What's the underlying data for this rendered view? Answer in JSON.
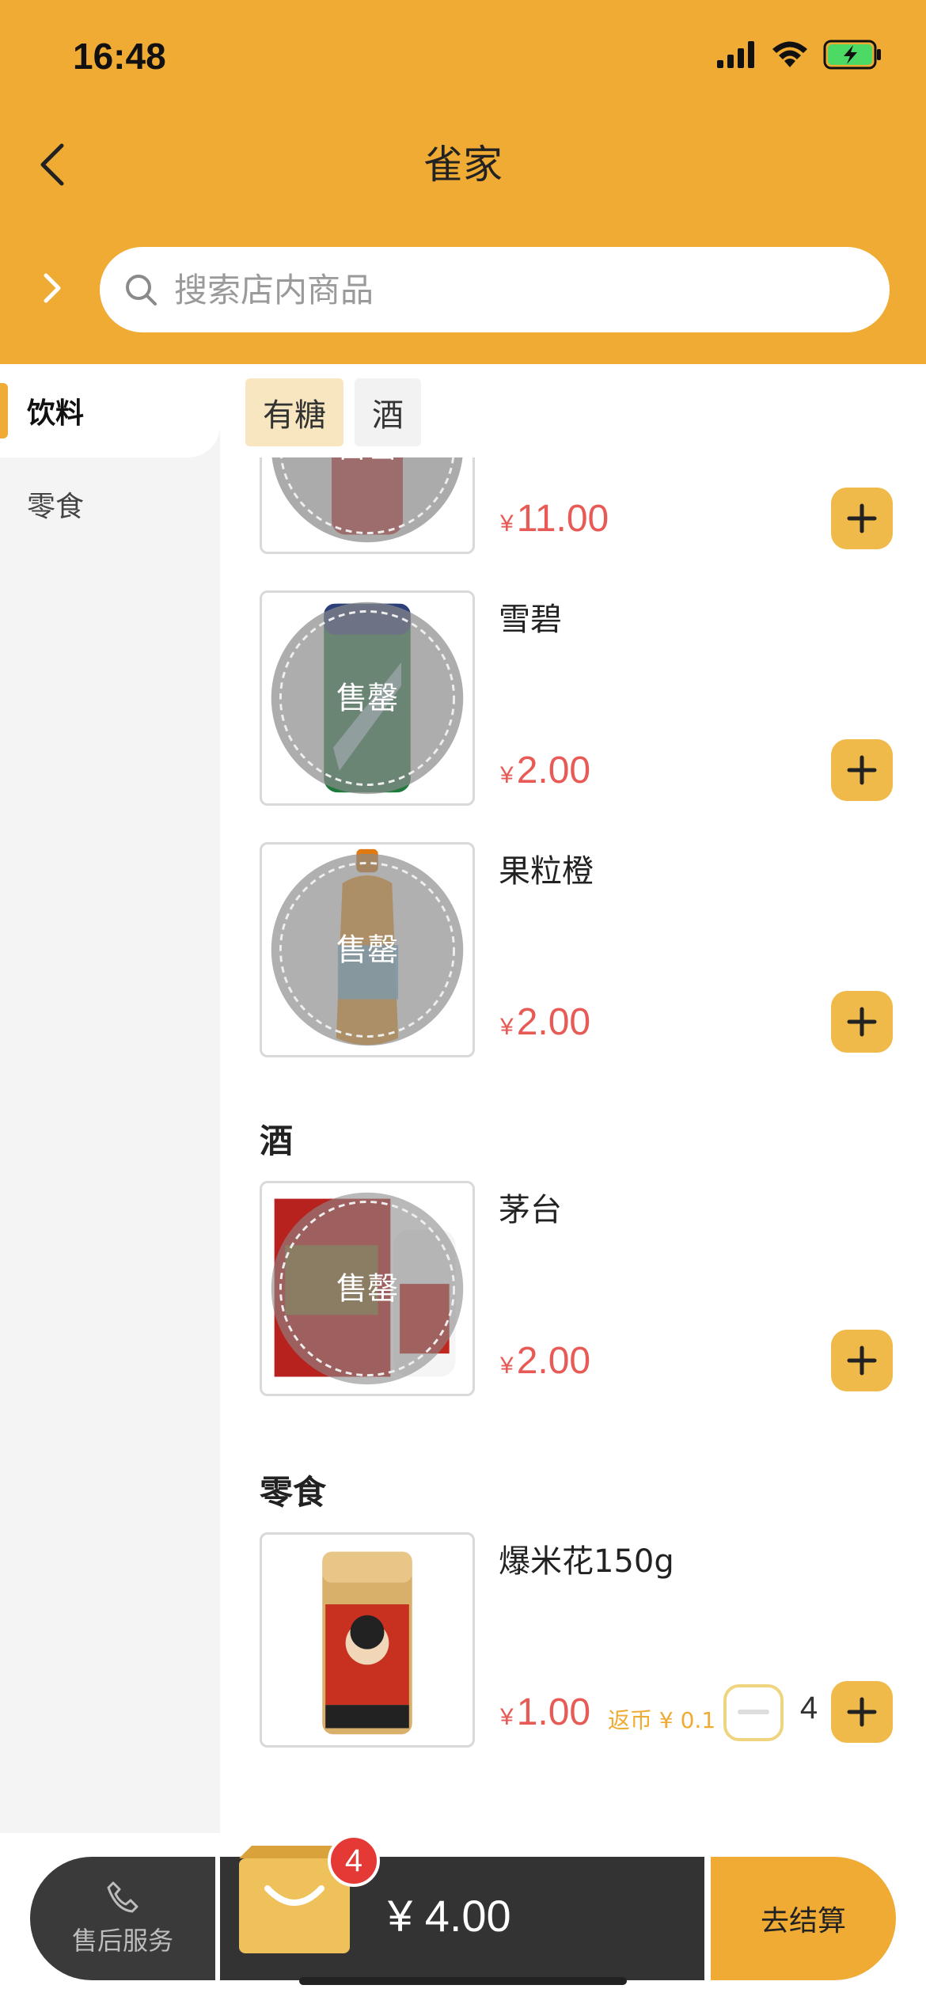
{
  "status_bar": {
    "time": "16:48"
  },
  "nav": {
    "title": "雀家"
  },
  "search": {
    "placeholder": "搜索店内商品"
  },
  "sidebar": {
    "items": [
      {
        "label": "饮料",
        "active": true
      },
      {
        "label": "零食",
        "active": false
      }
    ]
  },
  "tags": [
    {
      "label": "有糖",
      "active": true
    },
    {
      "label": "酒",
      "active": false
    }
  ],
  "currency_symbol": "¥",
  "sections": [
    {
      "title": "酒"
    },
    {
      "title": "零食"
    }
  ],
  "products": [
    {
      "name": "",
      "price": "11.00",
      "sold_out_label": "售罄",
      "image": "cola-can"
    },
    {
      "name": "雪碧",
      "price": "2.00",
      "sold_out_label": "售罄",
      "image": "sprite-can"
    },
    {
      "name": "果粒橙",
      "price": "2.00",
      "sold_out_label": "售罄",
      "image": "orange-bottle"
    },
    {
      "name": "茅台",
      "price": "2.00",
      "sold_out_label": "售罄",
      "image": "maotai-box"
    },
    {
      "name": "爆米花150g",
      "price": "1.00",
      "rebate": "返币 ¥ 0.1",
      "quantity": "4",
      "image": "popcorn-jar"
    }
  ],
  "bottom_bar": {
    "service_label": "售后服务",
    "cart_badge": "4",
    "total": "¥ 4.00",
    "checkout_label": "去结算"
  },
  "colors": {
    "brand": "#EFAB34",
    "price": "#E85A55",
    "dark": "#333333"
  }
}
